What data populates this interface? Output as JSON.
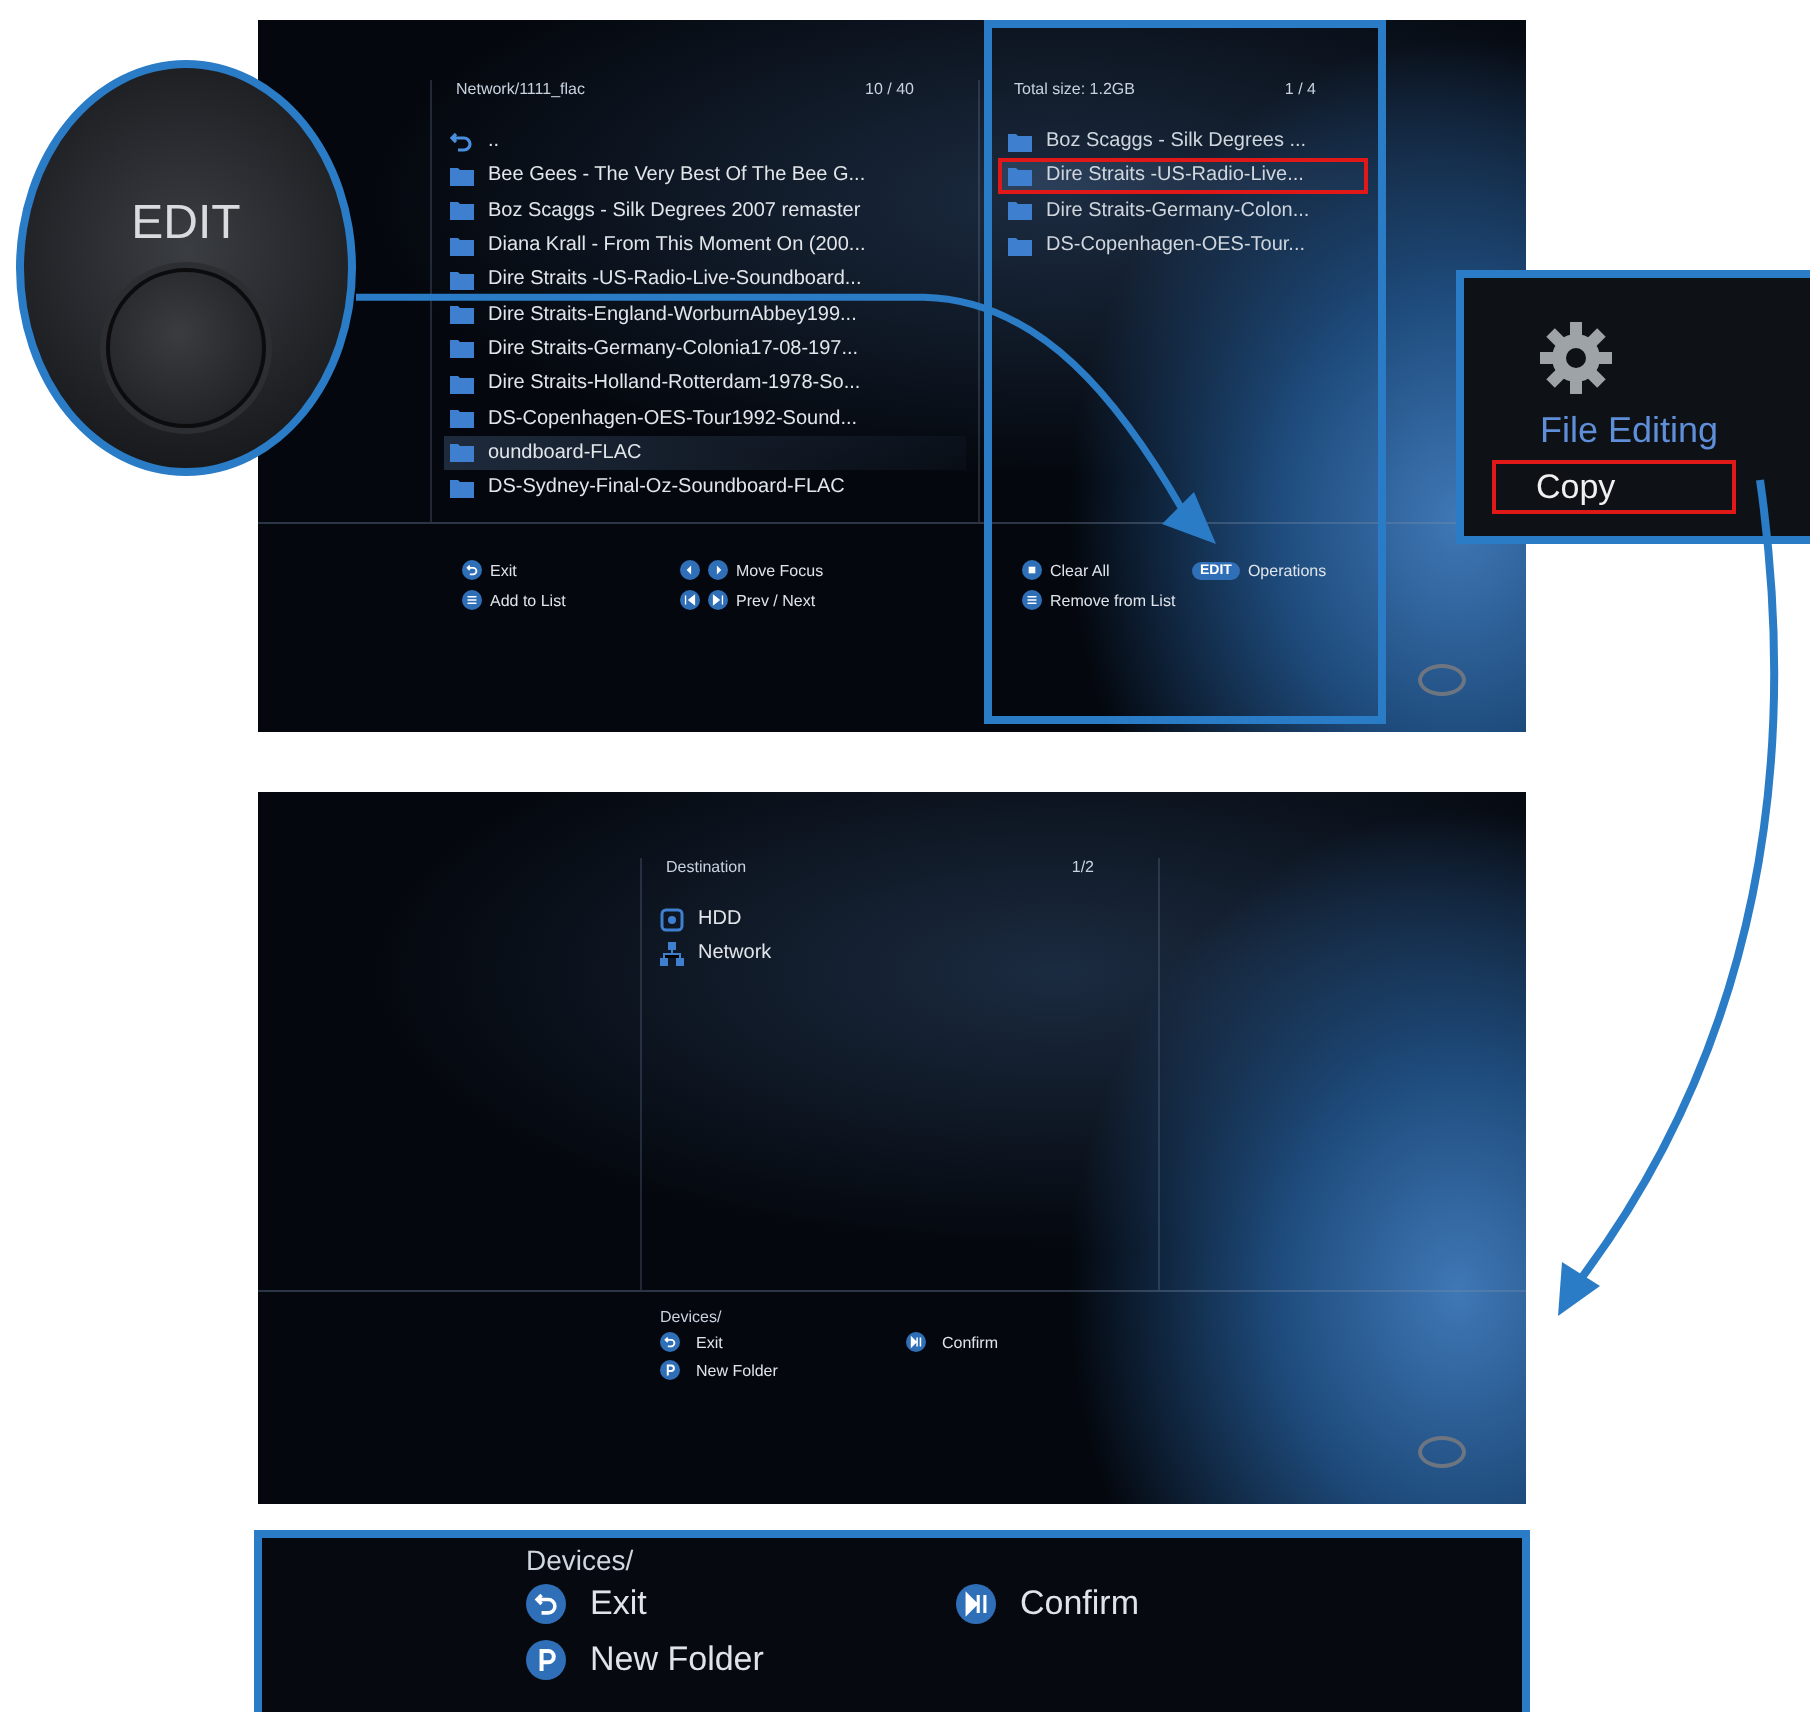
{
  "remote_closeup": {
    "label": "EDIT"
  },
  "file_browser": {
    "path": "Network/1111_flac",
    "count": "10 / 40",
    "items": [
      {
        "kind": "up",
        "label": "..",
        "selected": false
      },
      {
        "kind": "folder",
        "label": "Bee Gees - The Very Best Of The Bee G...",
        "selected": false
      },
      {
        "kind": "folder",
        "label": "Boz Scaggs - Silk Degrees 2007 remaster",
        "selected": false
      },
      {
        "kind": "folder",
        "label": "Diana Krall - From This Moment On (200...",
        "selected": false
      },
      {
        "kind": "folder",
        "label": "Dire Straits -US-Radio-Live-Soundboard...",
        "selected": false
      },
      {
        "kind": "folder",
        "label": "Dire Straits-England-WorburnAbbey199...",
        "selected": false
      },
      {
        "kind": "folder",
        "label": "Dire Straits-Germany-Colonia17-08-197...",
        "selected": false
      },
      {
        "kind": "folder",
        "label": "Dire Straits-Holland-Rotterdam-1978-So...",
        "selected": false
      },
      {
        "kind": "folder",
        "label": "DS-Copenhagen-OES-Tour1992-Sound...",
        "selected": false
      },
      {
        "kind": "folder",
        "label": "oundboard-FLAC",
        "selected": true
      },
      {
        "kind": "folder",
        "label": "DS-Sydney-Final-Oz-Soundboard-FLAC",
        "selected": false
      }
    ],
    "copy_list": {
      "title": "Total size: 1.2GB",
      "count": "1 / 4",
      "highlighted": true,
      "items": [
        {
          "label": "Boz Scaggs - Silk Degrees ...",
          "selected": false
        },
        {
          "label": "Dire Straits -US-Radio-Live...",
          "selected": true
        },
        {
          "label": "Dire Straits-Germany-Colon...",
          "selected": false
        },
        {
          "label": "DS-Copenhagen-OES-Tour...",
          "selected": false
        }
      ]
    },
    "hints": [
      {
        "keys": [
          {
            "kind": "back"
          }
        ],
        "label": "Exit"
      },
      {
        "keys": [
          {
            "kind": "left"
          },
          {
            "kind": "right"
          }
        ],
        "label": "Move Focus"
      },
      {
        "keys": [
          {
            "kind": "stop"
          }
        ],
        "label": "Clear All"
      },
      {
        "keys": [
          {
            "kind": "text",
            "text": "EDIT"
          }
        ],
        "label": "Operations"
      },
      {
        "keys": [
          {
            "kind": "list"
          }
        ],
        "label": "Add to List"
      },
      {
        "keys": [
          {
            "kind": "prev"
          },
          {
            "kind": "next"
          }
        ],
        "label": "Prev / Next"
      },
      {
        "keys": [
          {
            "kind": "list"
          }
        ],
        "label": "Remove from List"
      }
    ]
  },
  "menu_callout": {
    "title": "File Editing",
    "items": [
      {
        "label": "Copy",
        "selected": true
      }
    ]
  },
  "destination_screen": {
    "title": "Destination",
    "count": "1/2",
    "items": [
      {
        "kind": "hdd",
        "label": "HDD"
      },
      {
        "kind": "network",
        "label": "Network"
      }
    ],
    "path": "Devices/",
    "hints": [
      {
        "keys": [
          {
            "kind": "back"
          }
        ],
        "label": "Exit"
      },
      {
        "keys": [
          {
            "kind": "playpause"
          }
        ],
        "label": "Confirm"
      },
      {
        "keys": [
          {
            "kind": "folder"
          }
        ],
        "label": "New Folder"
      }
    ]
  },
  "footer_closeup": {
    "path": "Devices/",
    "hints": [
      {
        "keys": [
          {
            "kind": "back"
          }
        ],
        "label": "Exit"
      },
      {
        "keys": [
          {
            "kind": "playpause"
          }
        ],
        "label": "Confirm"
      },
      {
        "keys": [
          {
            "kind": "folder"
          }
        ],
        "label": "New Folder"
      }
    ]
  }
}
